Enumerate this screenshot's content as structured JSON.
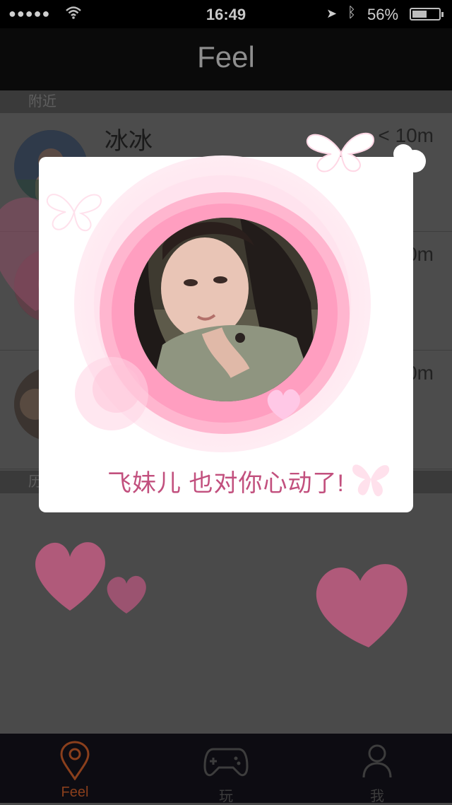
{
  "status_bar": {
    "signal": "●●●●●",
    "time": "16:49",
    "battery": "56%",
    "battery_level": 0.56
  },
  "nav": {
    "title": "Feel"
  },
  "sections": [
    {
      "title": "附近"
    },
    {
      "title": "历"
    }
  ],
  "list": [
    {
      "name": "冰冰",
      "distance": "< 10m"
    },
    {
      "name": "",
      "distance": "0m"
    },
    {
      "name": "",
      "distance": "0m"
    }
  ],
  "modal": {
    "message": "飞妹儿 也对你心动了!"
  },
  "tabs": [
    {
      "label": "Feel",
      "icon": "location-pin-icon"
    },
    {
      "label": "玩",
      "icon": "gamepad-icon"
    },
    {
      "label": "我",
      "icon": "person-icon"
    }
  ],
  "colors": {
    "accent_pink": "#c2507e",
    "heart_pink": "#b05a7a",
    "tab_active": "#8a3f1c"
  }
}
